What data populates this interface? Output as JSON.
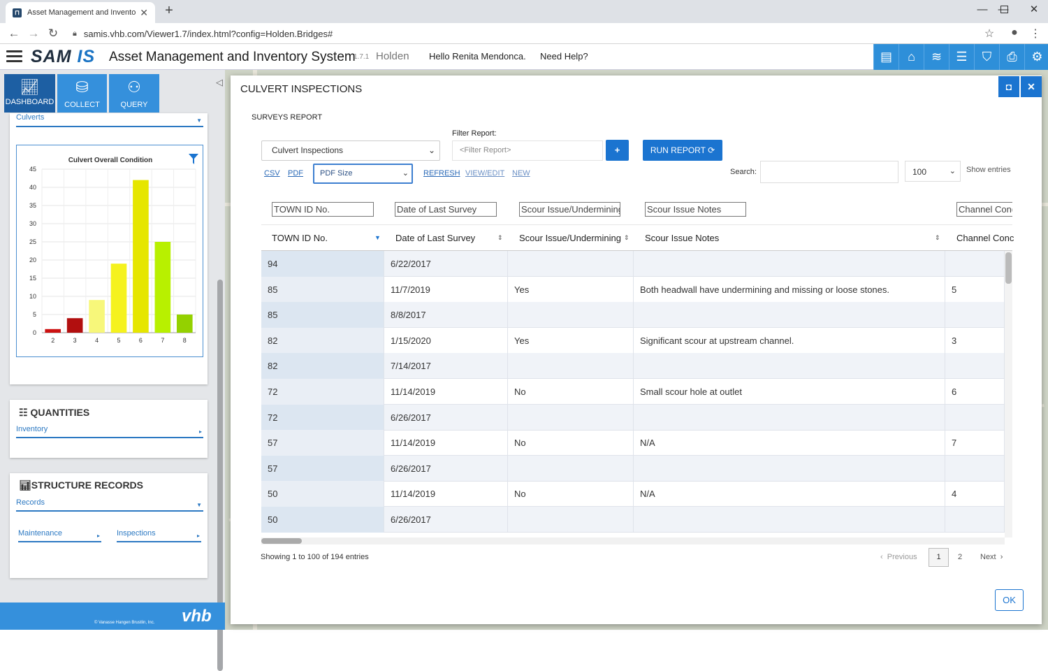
{
  "browser": {
    "tab_title": "Asset Management and Inventor",
    "url": "samis.vhb.com/Viewer1.7/index.html?config=Holden.Bridges#"
  },
  "header": {
    "logo_a": "SAM",
    "logo_b": "IS",
    "title": "Asset Management and Inventory System",
    "version": "1.7.1",
    "town": "Holden",
    "greeting": "Hello Renita Mendonca.",
    "help": "Need Help?"
  },
  "sidebar": {
    "nav": [
      {
        "label": "DASHBOARD",
        "icon": "chart-line-icon",
        "active": true
      },
      {
        "label": "COLLECT",
        "icon": "database-icon",
        "active": false
      },
      {
        "label": "QUERY",
        "icon": "binoculars-icon",
        "active": false
      }
    ],
    "dropdown": "Culverts",
    "quantities_title": "QUANTITIES",
    "quantities_link": "Inventory",
    "structure_title": "STRUCTURE RECORDS",
    "records_link": "Records",
    "maintenance_link": "Maintenance",
    "inspections_link": "Inspections",
    "footer_copy": "© Vanasse Hangen Brustlin, Inc.",
    "footer_logo": "vhb"
  },
  "chart_data": {
    "type": "bar",
    "title": "Culvert Overall Condition",
    "categories": [
      "2",
      "3",
      "4",
      "5",
      "6",
      "7",
      "8"
    ],
    "values": [
      1,
      4,
      9,
      19,
      42,
      25,
      5
    ],
    "colors": [
      "#cc1111",
      "#b20f0f",
      "#f7f77a",
      "#f5f21e",
      "#e6e600",
      "#b8f000",
      "#94d100"
    ],
    "ylim": [
      0,
      45
    ],
    "yticks": [
      "0",
      "5",
      "10",
      "15",
      "20",
      "25",
      "30",
      "35",
      "40",
      "45"
    ],
    "grid": true
  },
  "modal": {
    "title": "CULVERT INSPECTIONS",
    "subtitle": "SURVEYS REPORT",
    "report_select": "Culvert Inspections",
    "filter_label": "Filter Report:",
    "filter_placeholder": "<Filter Report>",
    "run_label": "RUN REPORT",
    "csv": "CSV",
    "pdf": "PDF",
    "pdf_size": "PDF Size",
    "refresh": "REFRESH",
    "view_edit": "VIEW/EDIT",
    "new": "NEW",
    "search_label": "Search:",
    "entries_value": "100",
    "entries_label": "Show entries",
    "filters": [
      "TOWN ID No.",
      "Date of Last Survey",
      "Scour Issue/Undermining",
      "Scour Issue Notes",
      "Channel Condition"
    ],
    "columns": [
      "TOWN ID No.",
      "Date of Last Survey",
      "Scour Issue/Undermining",
      "Scour Issue Notes",
      "Channel Conc"
    ],
    "rows": [
      [
        "94",
        "6/22/2017",
        "",
        "",
        ""
      ],
      [
        "85",
        "11/7/2019",
        "Yes",
        "Both headwall have undermining and missing or loose stones.",
        "5"
      ],
      [
        "85",
        "8/8/2017",
        "",
        "",
        ""
      ],
      [
        "82",
        "1/15/2020",
        "Yes",
        "Significant scour at upstream channel.",
        "3"
      ],
      [
        "82",
        "7/14/2017",
        "",
        "",
        ""
      ],
      [
        "72",
        "11/14/2019",
        "No",
        "Small scour hole at outlet",
        "6"
      ],
      [
        "72",
        "6/26/2017",
        "",
        "",
        ""
      ],
      [
        "57",
        "11/14/2019",
        "No",
        "N/A",
        "7"
      ],
      [
        "57",
        "6/26/2017",
        "",
        "",
        ""
      ],
      [
        "50",
        "11/14/2019",
        "No",
        "N/A",
        "4"
      ],
      [
        "50",
        "6/26/2017",
        "",
        "",
        ""
      ]
    ],
    "info": "Showing 1 to 100 of 194 entries",
    "prev": "Previous",
    "page1": "1",
    "page2": "2",
    "next": "Next",
    "ok": "OK"
  }
}
